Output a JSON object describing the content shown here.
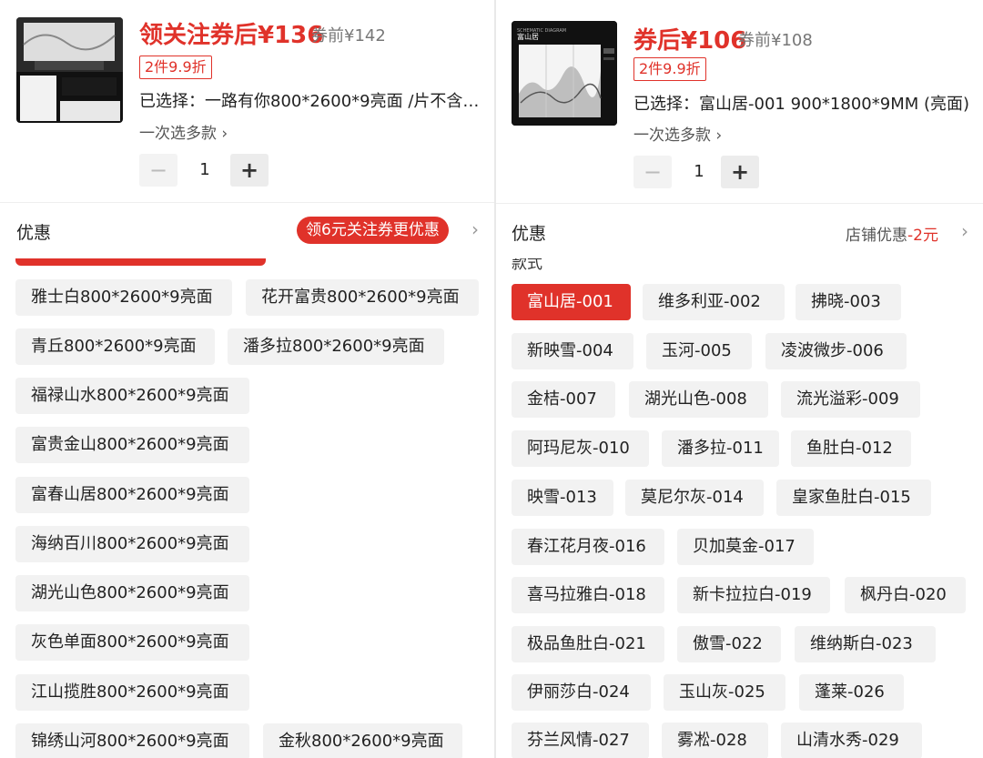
{
  "left": {
    "price": "领关注券后¥136",
    "original_price": "券前¥142",
    "tag": "2件9.9折",
    "selected": "已选择：一路有你800*2600*9亮面 /片不含…",
    "multi_select": "一次选多款",
    "quantity": "1",
    "promo_label": "优惠",
    "promo_pill": "领6元关注券更优惠",
    "options": [
      "雅士白800*2600*9亮面",
      "花开富贵800*2600*9亮面",
      "青丘800*2600*9亮面",
      "潘多拉800*2600*9亮面",
      "福禄山水800*2600*9亮面",
      "富贵金山800*2600*9亮面",
      "富春山居800*2600*9亮面",
      "海纳百川800*2600*9亮面",
      "湖光山色800*2600*9亮面",
      "灰色单面800*2600*9亮面",
      "江山揽胜800*2600*9亮面",
      "锦绣山河800*2600*9亮面",
      "金秋800*2600*9亮面"
    ]
  },
  "right": {
    "price": "券后¥106",
    "original_price": "券前¥108",
    "tag": "2件9.9折",
    "selected": "已选择：富山居-001 900*1800*9MM (亮面)",
    "multi_select": "一次选多款",
    "quantity": "1",
    "promo_label": "优惠",
    "shop_promo_text": "店铺优惠",
    "shop_promo_amount": "-2元",
    "section_label": "款式",
    "thumb_title": "富山居",
    "options": [
      "富山居-001",
      "维多利亚-002",
      "拂晓-003",
      "新映雪-004",
      "玉河-005",
      "凌波微步-006",
      "金桔-007",
      "湖光山色-008",
      "流光溢彩-009",
      "阿玛尼灰-010",
      "潘多拉-011",
      "鱼肚白-012",
      "映雪-013",
      "莫尼尔灰-014",
      "皇家鱼肚白-015",
      "春江花月夜-016",
      "贝加莫金-017",
      "喜马拉雅白-018",
      "新卡拉拉白-019",
      "枫丹白-020",
      "极品鱼肚白-021",
      "傲雪-022",
      "维纳斯白-023",
      "伊丽莎白-024",
      "玉山灰-025",
      "蓬莱-026",
      "芬兰风情-027",
      "雾凇-028",
      "山清水秀-029"
    ]
  },
  "icons": {
    "chevron": "›",
    "minus": "−",
    "plus": "+"
  },
  "colors": {
    "accent": "#e0322a",
    "chip_bg": "#f2f2f2"
  }
}
